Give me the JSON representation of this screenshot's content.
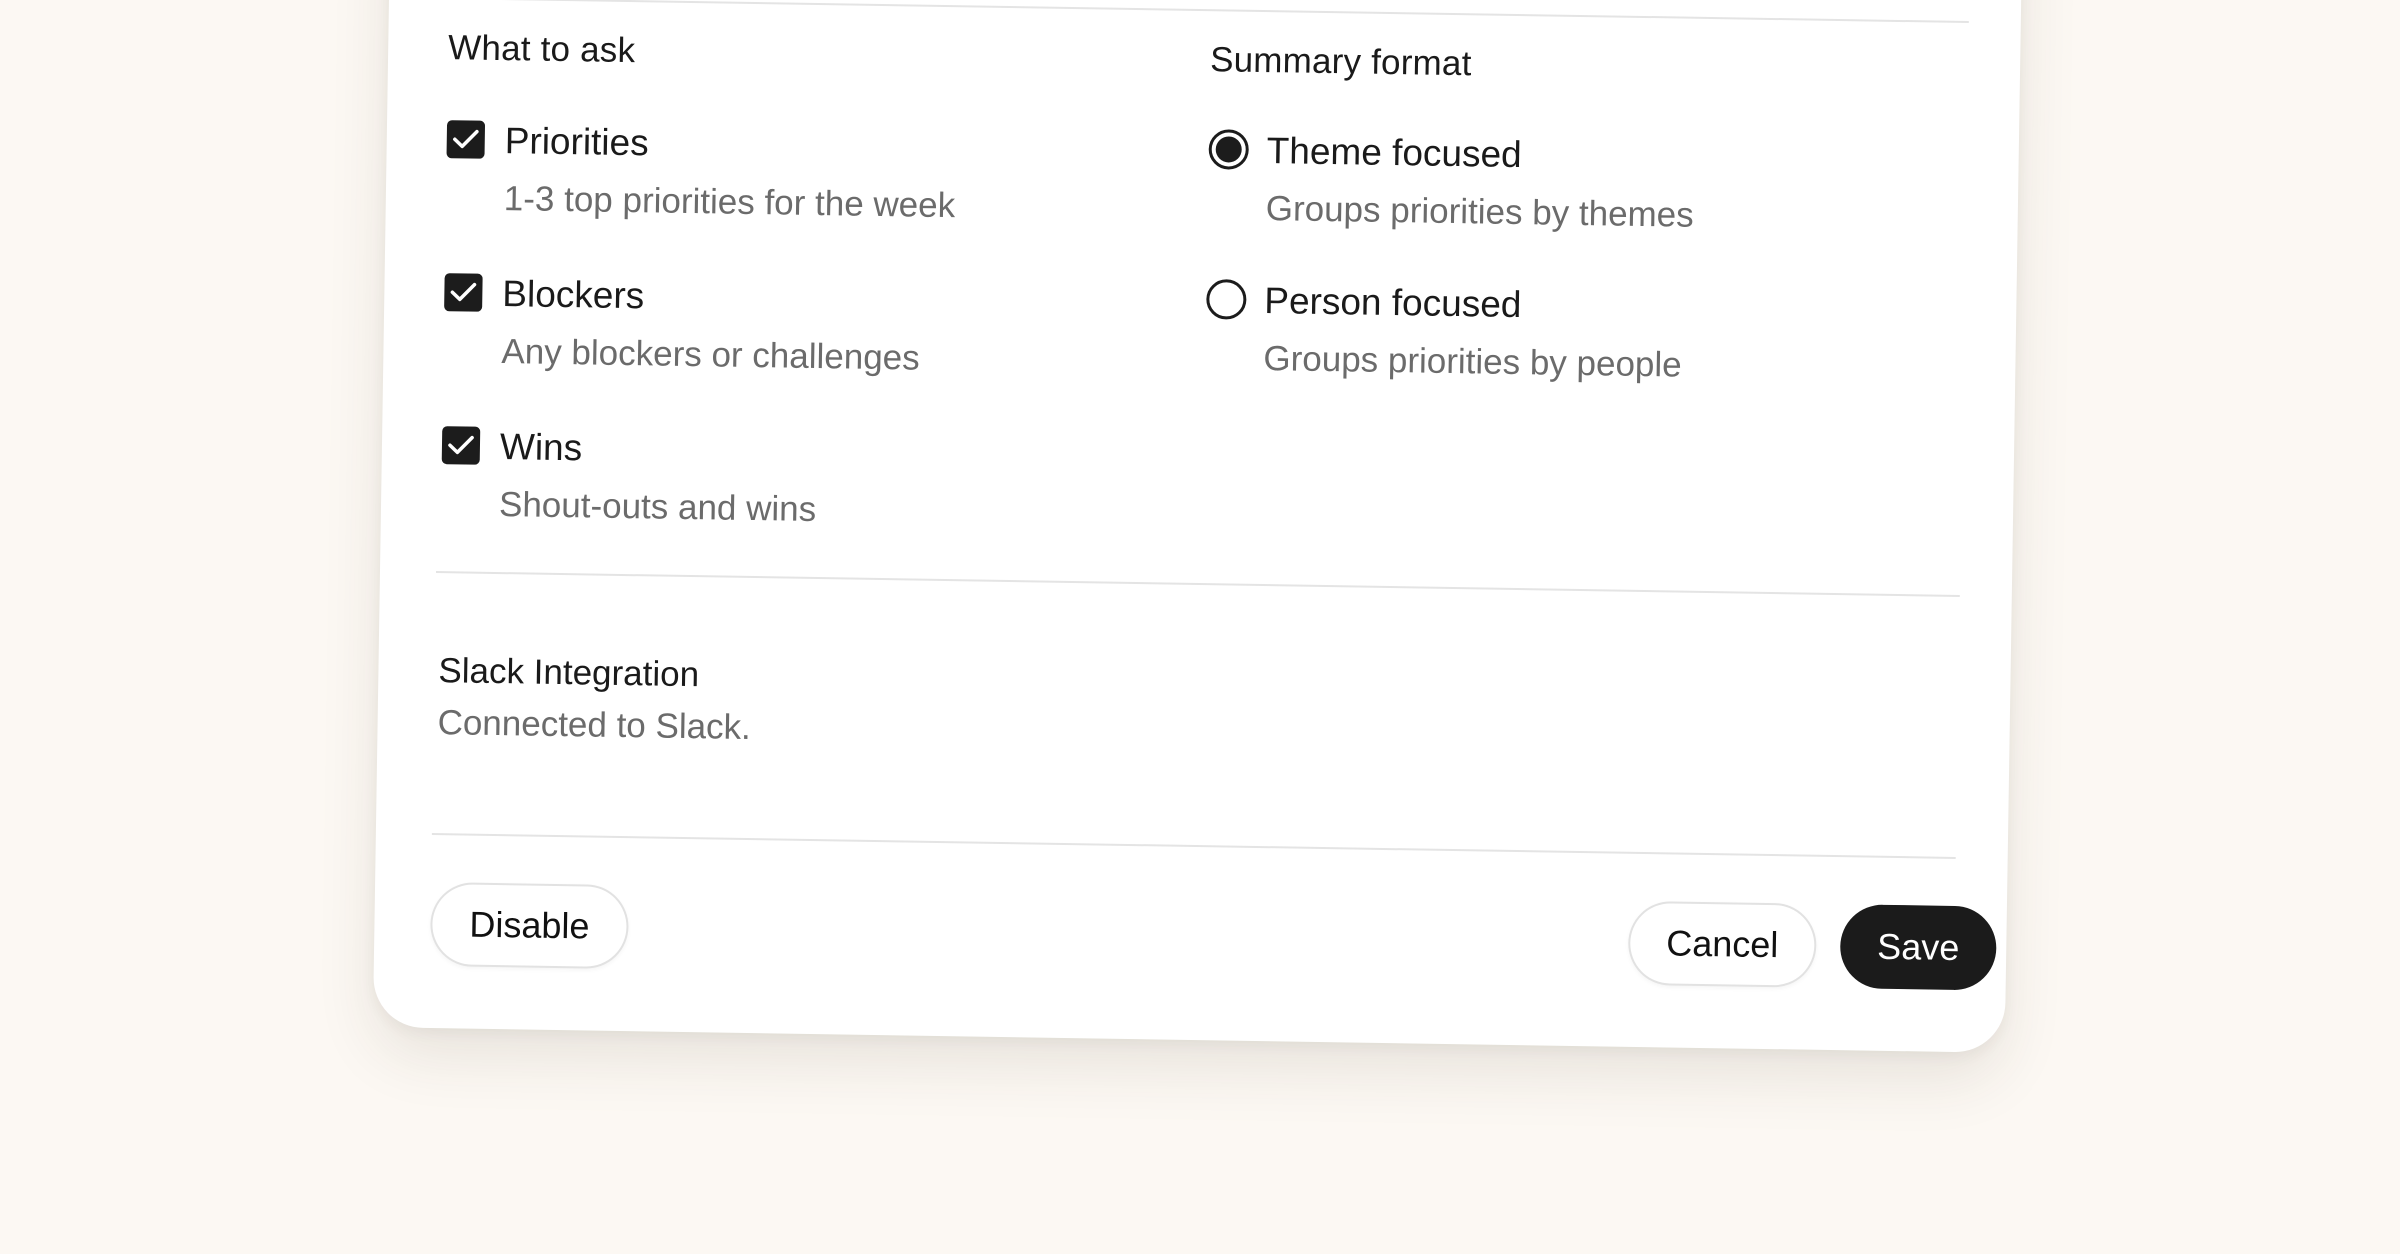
{
  "what_to_ask": {
    "heading": "What to ask",
    "options": [
      {
        "label": "Priorities",
        "description": "1-3 top priorities for the week",
        "checked": true
      },
      {
        "label": "Blockers",
        "description": "Any blockers or challenges",
        "checked": true
      },
      {
        "label": "Wins",
        "description": "Shout-outs and wins",
        "checked": true
      }
    ]
  },
  "summary_format": {
    "heading": "Summary format",
    "options": [
      {
        "label": "Theme focused",
        "description": "Groups priorities by themes",
        "selected": true
      },
      {
        "label": "Person focused",
        "description": "Groups priorities by people",
        "selected": false
      }
    ]
  },
  "slack": {
    "title": "Slack Integration",
    "status": "Connected to Slack."
  },
  "footer": {
    "disable_label": "Disable",
    "cancel_label": "Cancel",
    "save_label": "Save"
  },
  "colors": {
    "page_background": "#fcf8f3",
    "card_background": "#ffffff",
    "primary": "#1b1b1b",
    "muted_text": "#6b6b6b"
  }
}
